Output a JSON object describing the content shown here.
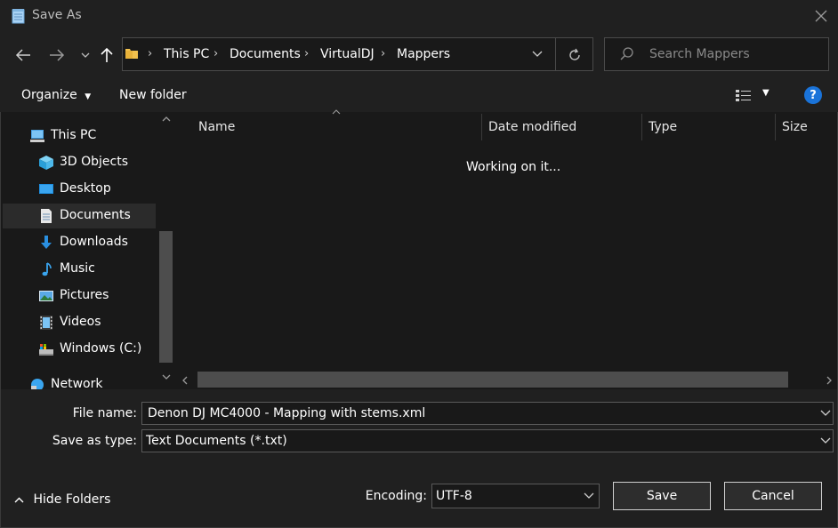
{
  "window": {
    "title": "Save As"
  },
  "nav": {
    "breadcrumbs": [
      "This PC",
      "Documents",
      "VirtualDJ",
      "Mappers"
    ],
    "search_placeholder": "Search Mappers"
  },
  "toolbar": {
    "organize_label": "Organize",
    "new_folder_label": "New folder",
    "help_label": "?"
  },
  "sidebar": {
    "items": [
      {
        "label": "This PC",
        "icon": "computer-icon"
      },
      {
        "label": "3D Objects",
        "icon": "cube-icon"
      },
      {
        "label": "Desktop",
        "icon": "desktop-icon"
      },
      {
        "label": "Documents",
        "icon": "document-icon",
        "selected": true
      },
      {
        "label": "Downloads",
        "icon": "download-icon"
      },
      {
        "label": "Music",
        "icon": "music-icon"
      },
      {
        "label": "Pictures",
        "icon": "picture-icon"
      },
      {
        "label": "Videos",
        "icon": "video-icon"
      },
      {
        "label": "Windows (C:)",
        "icon": "drive-icon"
      },
      {
        "label": "Network",
        "icon": "network-icon"
      }
    ]
  },
  "filelist": {
    "columns": [
      "Name",
      "Date modified",
      "Type",
      "Size"
    ],
    "status_text": "Working on it..."
  },
  "form": {
    "file_name_label": "File name:",
    "file_name_value": "Denon DJ MC4000 - Mapping  with stems.xml",
    "save_type_label": "Save as type:",
    "save_type_value": "Text Documents (*.txt)",
    "encoding_label": "Encoding:",
    "encoding_value": "UTF-8"
  },
  "buttons": {
    "save_label": "Save",
    "cancel_label": "Cancel",
    "hide_folders_label": "Hide Folders"
  },
  "colors": {
    "background": "#191919",
    "chrome": "#202020",
    "accent": "#1a73d9",
    "selected": "#2b2b2b"
  }
}
